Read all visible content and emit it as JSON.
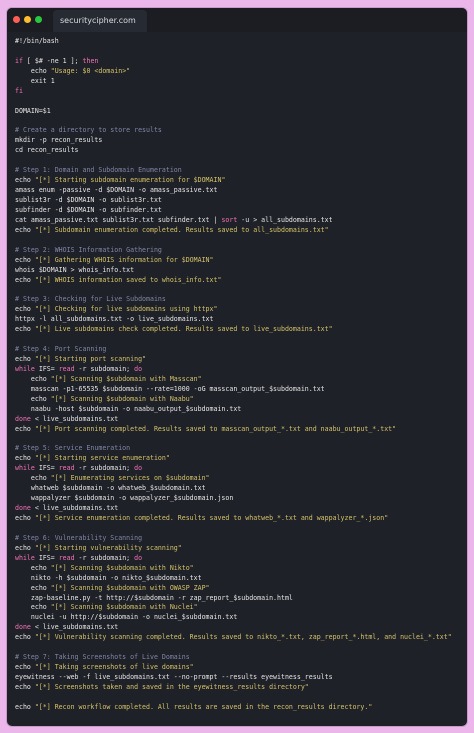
{
  "window": {
    "tab_title": "securitycipher.com",
    "dots": [
      {
        "name": "close-dot",
        "color": "#ff5f57"
      },
      {
        "name": "minimize-dot",
        "color": "#febc2e"
      },
      {
        "name": "maximize-dot",
        "color": "#28c840"
      }
    ]
  },
  "colors": {
    "background": "#ebb6ea",
    "window": "#1f2128",
    "default": "#e6e6e6",
    "comment": "#7f86a6",
    "keyword": "#f472b6",
    "string": "#d4c268",
    "variable": "#e6e6e6"
  },
  "code": {
    "lines": [
      [
        [
          "#!/bin/bash",
          "default"
        ]
      ],
      [],
      [
        [
          "if",
          "keyword"
        ],
        [
          " [ $# -ne 1 ]; ",
          "default"
        ],
        [
          "then",
          "keyword"
        ]
      ],
      [
        [
          "    echo ",
          "default"
        ],
        [
          "\"Usage: $0 <domain>\"",
          "string"
        ]
      ],
      [
        [
          "    exit 1",
          "default"
        ]
      ],
      [
        [
          "fi",
          "keyword"
        ]
      ],
      [],
      [
        [
          "DOMAIN=$1",
          "default"
        ]
      ],
      [],
      [
        [
          "# Create a directory to store results",
          "comment"
        ]
      ],
      [
        [
          "mkdir -p recon_results",
          "default"
        ]
      ],
      [
        [
          "cd recon_results",
          "default"
        ]
      ],
      [],
      [
        [
          "# Step 1: Domain and Subdomain Enumeration",
          "comment"
        ]
      ],
      [
        [
          "echo ",
          "default"
        ],
        [
          "\"[*] Starting subdomain enumeration for $DOMAIN\"",
          "string"
        ]
      ],
      [
        [
          "amass enum -passive -d $DOMAIN -o amass_passive.txt",
          "default"
        ]
      ],
      [
        [
          "sublist3r -d $DOMAIN -o sublist3r.txt",
          "default"
        ]
      ],
      [
        [
          "subfinder -d $DOMAIN -o subfinder.txt",
          "default"
        ]
      ],
      [
        [
          "cat amass_passive.txt sublist3r.txt subfinder.txt | ",
          "default"
        ],
        [
          "sort",
          "keyword"
        ],
        [
          " -u > all_subdomains.txt",
          "default"
        ]
      ],
      [
        [
          "echo ",
          "default"
        ],
        [
          "\"[*] Subdomain enumeration completed. Results saved to all_subdomains.txt\"",
          "string"
        ]
      ],
      [],
      [
        [
          "# Step 2: WHOIS Information Gathering",
          "comment"
        ]
      ],
      [
        [
          "echo ",
          "default"
        ],
        [
          "\"[*] Gathering WHOIS information for $DOMAIN\"",
          "string"
        ]
      ],
      [
        [
          "whois $DOMAIN > whois_info.txt",
          "default"
        ]
      ],
      [
        [
          "echo ",
          "default"
        ],
        [
          "\"[*] WHOIS information saved to whois_info.txt\"",
          "string"
        ]
      ],
      [],
      [
        [
          "# Step 3: Checking for Live Subdomains",
          "comment"
        ]
      ],
      [
        [
          "echo ",
          "default"
        ],
        [
          "\"[*] Checking for live subdomains using httpx\"",
          "string"
        ]
      ],
      [
        [
          "httpx -l all_subdomains.txt -o live_subdomains.txt",
          "default"
        ]
      ],
      [
        [
          "echo ",
          "default"
        ],
        [
          "\"[*] Live subdomains check completed. Results saved to live_subdomains.txt\"",
          "string"
        ]
      ],
      [],
      [
        [
          "# Step 4: Port Scanning",
          "comment"
        ]
      ],
      [
        [
          "echo ",
          "default"
        ],
        [
          "\"[*] Starting port scanning\"",
          "string"
        ]
      ],
      [
        [
          "while",
          "keyword"
        ],
        [
          " IFS= ",
          "default"
        ],
        [
          "read",
          "keyword"
        ],
        [
          " -r subdomain; ",
          "default"
        ],
        [
          "do",
          "keyword"
        ]
      ],
      [
        [
          "    echo ",
          "default"
        ],
        [
          "\"[*] Scanning $subdomain with Masscan\"",
          "string"
        ]
      ],
      [
        [
          "    masscan -p1-65535 $subdomain --rate=1000 -oG masscan_output_$subdomain.txt",
          "default"
        ]
      ],
      [
        [
          "    echo ",
          "default"
        ],
        [
          "\"[*] Scanning $subdomain with Naabu\"",
          "string"
        ]
      ],
      [
        [
          "    naabu -host $subdomain -o naabu_output_$subdomain.txt",
          "default"
        ]
      ],
      [
        [
          "done",
          "keyword"
        ],
        [
          " < live_subdomains.txt",
          "default"
        ]
      ],
      [
        [
          "echo ",
          "default"
        ],
        [
          "\"[*] Port scanning completed. Results saved to masscan_output_*.txt and naabu_output_*.txt\"",
          "string"
        ]
      ],
      [],
      [
        [
          "# Step 5: Service Enumeration",
          "comment"
        ]
      ],
      [
        [
          "echo ",
          "default"
        ],
        [
          "\"[*] Starting service enumeration\"",
          "string"
        ]
      ],
      [
        [
          "while",
          "keyword"
        ],
        [
          " IFS= ",
          "default"
        ],
        [
          "read",
          "keyword"
        ],
        [
          " -r subdomain; ",
          "default"
        ],
        [
          "do",
          "keyword"
        ]
      ],
      [
        [
          "    echo ",
          "default"
        ],
        [
          "\"[*] Enumerating services on $subdomain\"",
          "string"
        ]
      ],
      [
        [
          "    whatweb $subdomain -o whatweb_$subdomain.txt",
          "default"
        ]
      ],
      [
        [
          "    wappalyzer $subdomain -o wappalyzer_$subdomain.json",
          "default"
        ]
      ],
      [
        [
          "done",
          "keyword"
        ],
        [
          " < live_subdomains.txt",
          "default"
        ]
      ],
      [
        [
          "echo ",
          "default"
        ],
        [
          "\"[*] Service enumeration completed. Results saved to whatweb_*.txt and wappalyzer_*.json\"",
          "string"
        ]
      ],
      [],
      [
        [
          "# Step 6: Vulnerability Scanning",
          "comment"
        ]
      ],
      [
        [
          "echo ",
          "default"
        ],
        [
          "\"[*] Starting vulnerability scanning\"",
          "string"
        ]
      ],
      [
        [
          "while",
          "keyword"
        ],
        [
          " IFS= ",
          "default"
        ],
        [
          "read",
          "keyword"
        ],
        [
          " -r subdomain; ",
          "default"
        ],
        [
          "do",
          "keyword"
        ]
      ],
      [
        [
          "    echo ",
          "default"
        ],
        [
          "\"[*] Scanning $subdomain with Nikto\"",
          "string"
        ]
      ],
      [
        [
          "    nikto -h $subdomain -o nikto_$subdomain.txt",
          "default"
        ]
      ],
      [
        [
          "    echo ",
          "default"
        ],
        [
          "\"[*] Scanning $subdomain with OWASP ZAP\"",
          "string"
        ]
      ],
      [
        [
          "    zap-baseline.py -t http://$subdomain -r zap_report_$subdomain.html",
          "default"
        ]
      ],
      [
        [
          "    echo ",
          "default"
        ],
        [
          "\"[*] Scanning $subdomain with Nuclei\"",
          "string"
        ]
      ],
      [
        [
          "    nuclei -u http://$subdomain -o nuclei_$subdomain.txt",
          "default"
        ]
      ],
      [
        [
          "done",
          "keyword"
        ],
        [
          " < live_subdomains.txt",
          "default"
        ]
      ],
      [
        [
          "echo ",
          "default"
        ],
        [
          "\"[*] Vulnerability scanning completed. Results saved to nikto_*.txt, zap_report_*.html, and nuclei_*.txt\"",
          "string"
        ]
      ],
      [],
      [
        [
          "# Step 7: Taking Screenshots of Live Domains",
          "comment"
        ]
      ],
      [
        [
          "echo ",
          "default"
        ],
        [
          "\"[*] Taking screenshots of live domains\"",
          "string"
        ]
      ],
      [
        [
          "eyewitness --web -f live_subdomains.txt --no-prompt --results eyewitness_results",
          "default"
        ]
      ],
      [
        [
          "echo ",
          "default"
        ],
        [
          "\"[*] Screenshots taken and saved in the eyewitness_results directory\"",
          "string"
        ]
      ],
      [],
      [
        [
          "echo ",
          "default"
        ],
        [
          "\"[*] Recon workflow completed. All results are saved in the recon_results directory.\"",
          "string"
        ]
      ]
    ]
  }
}
